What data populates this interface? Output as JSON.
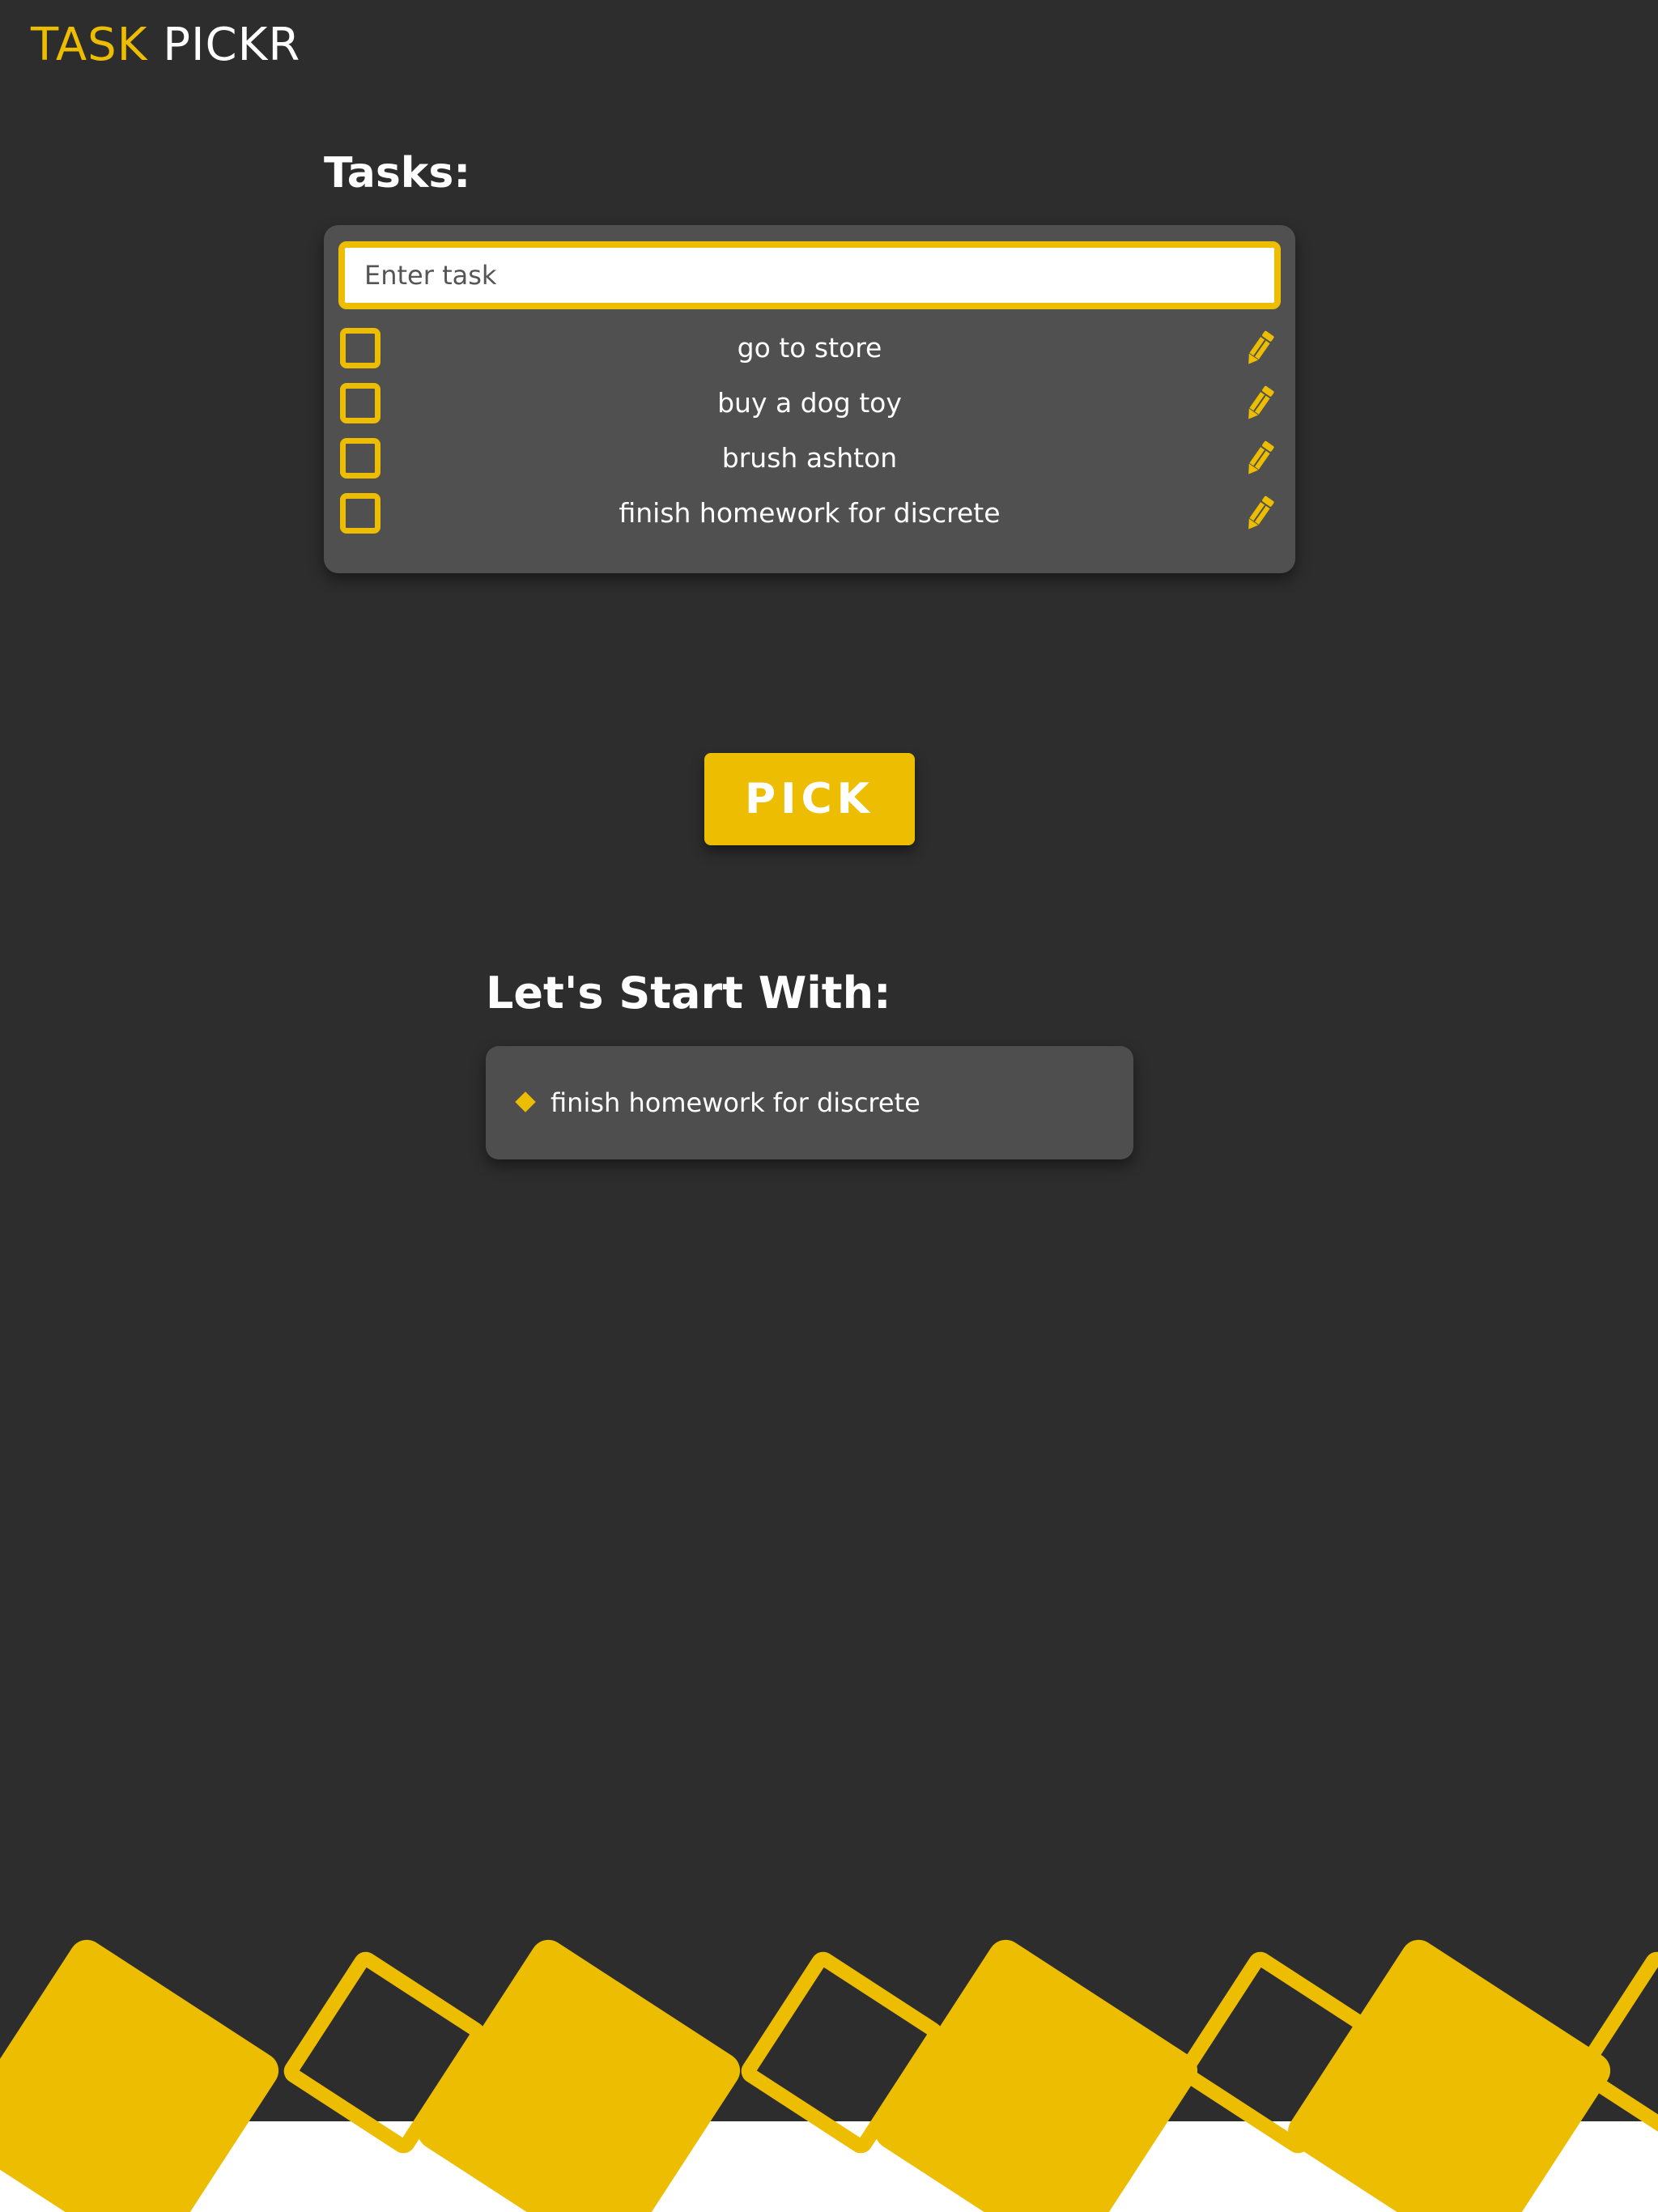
{
  "app": {
    "logo_accent": "TASK",
    "logo_rest": "PICKR"
  },
  "tasks": {
    "title": "Tasks:",
    "input_placeholder": "Enter task",
    "input_value": "",
    "items": [
      {
        "label": "go to store",
        "checked": false
      },
      {
        "label": "buy a dog toy",
        "checked": false
      },
      {
        "label": "brush ashton",
        "checked": false
      },
      {
        "label": "finish homework for discrete",
        "checked": false
      }
    ],
    "item_icon": "pencil-icon"
  },
  "pick": {
    "button_label": "PICK"
  },
  "result": {
    "title": "Let's Start With:",
    "bullet_icon": "diamond-icon",
    "task": "finish homework for discrete"
  },
  "colors": {
    "background": "#2d2d2d",
    "panel": "#505050",
    "accent": "#ecbd00",
    "text": "#ffffff"
  }
}
